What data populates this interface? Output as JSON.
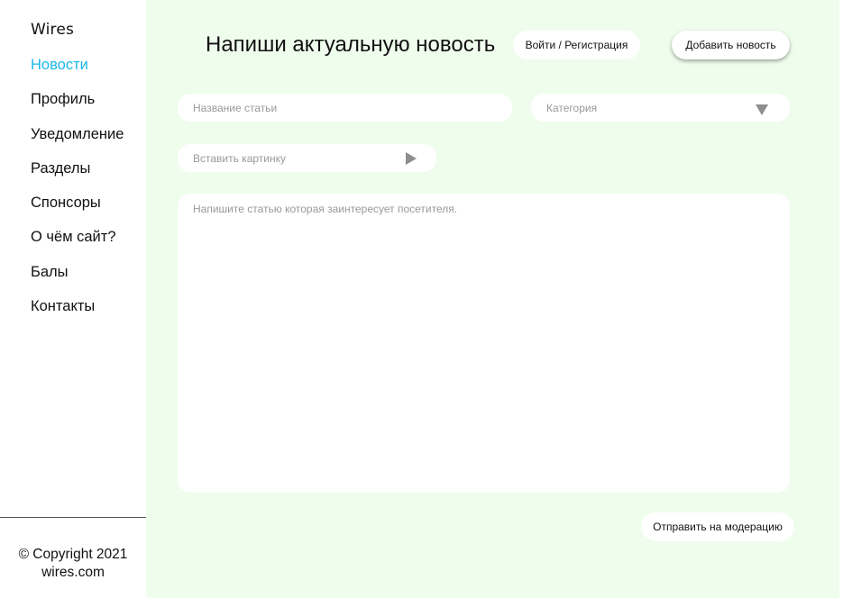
{
  "sidebar": {
    "logo": "Wires",
    "nav": [
      {
        "label": "Новости",
        "active": true
      },
      {
        "label": "Профиль"
      },
      {
        "label": "Уведомление"
      },
      {
        "label": "Разделы"
      },
      {
        "label": "Спонсоры"
      },
      {
        "label": "О чём сайт?"
      },
      {
        "label": "Балы"
      },
      {
        "label": "Контакты"
      }
    ],
    "copyright_line1": "© Copyright 2021",
    "copyright_line2": "wires.com"
  },
  "header": {
    "title": "Напиши актуальную новость",
    "login_label": "Войти / Регистрация",
    "add_news_label": "Добавить новость"
  },
  "form": {
    "title_placeholder": "Название статьи",
    "category_placeholder": "Категория",
    "image_placeholder": "Вставить картинку",
    "article_placeholder": "Напишите статью которая заинтересует посетителя.",
    "submit_label": "Отправить на модерацию"
  },
  "colors": {
    "accent": "#1ab8e8",
    "main_background": "#effdec"
  },
  "icons": {
    "category_dropdown": "triangle-down-icon",
    "image_insert": "triangle-right-icon"
  }
}
